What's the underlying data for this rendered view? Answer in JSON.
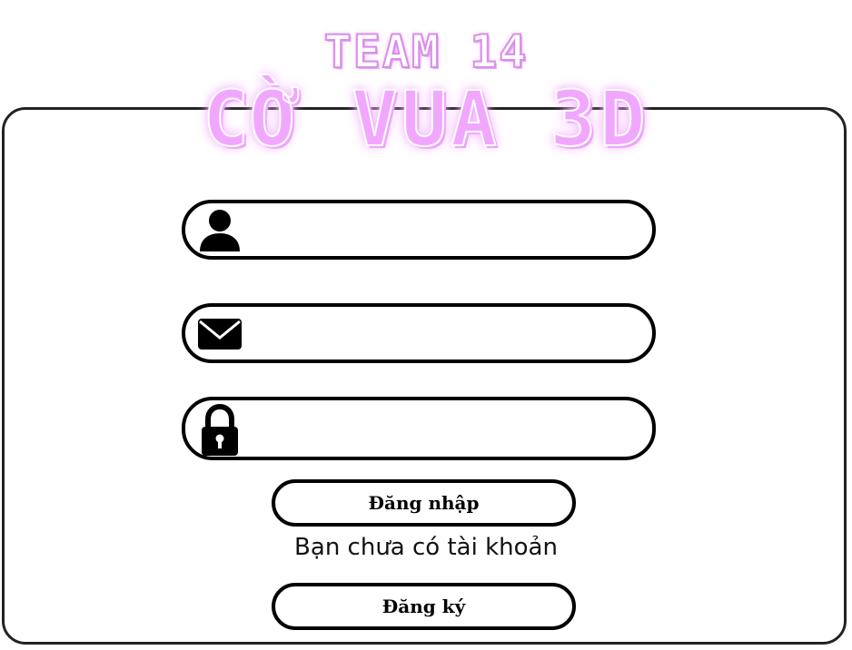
{
  "logo": {
    "line1": "TEAM 14",
    "line2": "CỜ VUA 3D"
  },
  "form": {
    "username": {
      "icon": "user-icon",
      "value": "",
      "placeholder": ""
    },
    "email": {
      "icon": "envelope-icon",
      "value": "",
      "placeholder": ""
    },
    "password": {
      "icon": "lock-icon",
      "value": "",
      "placeholder": ""
    },
    "login_label": "Đăng nhập",
    "no_account_text": "Bạn chưa có tài khoản",
    "register_label": "Đăng ký"
  },
  "colors": {
    "logo_pink": "#f2a7ff",
    "border": "#000000",
    "card_border": "#222222",
    "background": "#ffffff"
  }
}
